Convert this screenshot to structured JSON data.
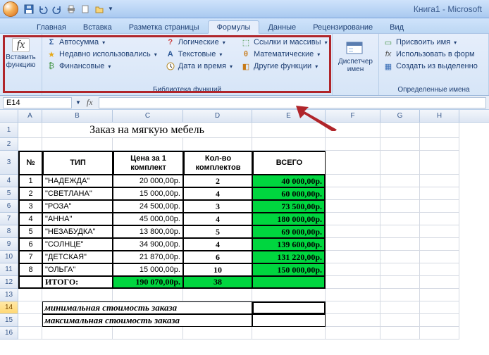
{
  "title": "Книга1  -  Microsoft",
  "tabs": [
    "Главная",
    "Вставка",
    "Разметка страницы",
    "Формулы",
    "Данные",
    "Рецензирование",
    "Вид"
  ],
  "active_tab": 3,
  "ribbon": {
    "insert_fn": "Вставить\nфункцию",
    "lib_label": "Библиотека функций",
    "col1": [
      "Автосумма",
      "Недавно использовались",
      "Финансовые"
    ],
    "col2": [
      "Логические",
      "Текстовые",
      "Дата и время"
    ],
    "col3": [
      "Ссылки и массивы",
      "Математические",
      "Другие функции"
    ],
    "name_mgr": "Диспетчер\nимен",
    "names_label": "Определенные имена",
    "names_items": [
      "Присвоить имя",
      "Использовать в форм",
      "Создать из выделенно"
    ]
  },
  "namebox": "E14",
  "colheaders": [
    "A",
    "B",
    "C",
    "D",
    "E",
    "F",
    "G",
    "H"
  ],
  "rowheaders": [
    "1",
    "2",
    "3",
    "4",
    "5",
    "6",
    "7",
    "8",
    "9",
    "10",
    "11",
    "12",
    "13",
    "14",
    "15",
    "16"
  ],
  "doc": {
    "title": "Заказ на мягкую мебель",
    "headers": {
      "no": "№",
      "type": "ТИП",
      "price": "Цена за 1 комплект",
      "qty": "Кол-во комплектов",
      "total": "ВСЕГО"
    },
    "rows": [
      {
        "no": "1",
        "type": "\"НАДЕЖДА\"",
        "price": "20 000,00р.",
        "qty": "2",
        "total": "40 000,00р."
      },
      {
        "no": "2",
        "type": "\"СВЕТЛАНА\"",
        "price": "15 000,00р.",
        "qty": "4",
        "total": "60 000,00р."
      },
      {
        "no": "3",
        "type": "\"РОЗА\"",
        "price": "24 500,00р.",
        "qty": "3",
        "total": "73 500,00р."
      },
      {
        "no": "4",
        "type": "\"АННА\"",
        "price": "45 000,00р.",
        "qty": "4",
        "total": "180 000,00р."
      },
      {
        "no": "5",
        "type": "\"НЕЗАБУДКА\"",
        "price": "13 800,00р.",
        "qty": "5",
        "total": "69 000,00р."
      },
      {
        "no": "6",
        "type": "\"СОЛНЦЕ\"",
        "price": "34 900,00р.",
        "qty": "4",
        "total": "139 600,00р."
      },
      {
        "no": "7",
        "type": "\"ДЕТСКАЯ\"",
        "price": "21 870,00р.",
        "qty": "6",
        "total": "131 220,00р."
      },
      {
        "no": "8",
        "type": "\"ОЛЬГА\"",
        "price": "15 000,00р.",
        "qty": "10",
        "total": "150 000,00р."
      }
    ],
    "total_row": {
      "label": "ИТОГО:",
      "price": "190 070,00р.",
      "qty": "38",
      "total": ""
    },
    "min_label": "минимальная стоимость заказа",
    "max_label": "максимальная стоимость заказа"
  }
}
